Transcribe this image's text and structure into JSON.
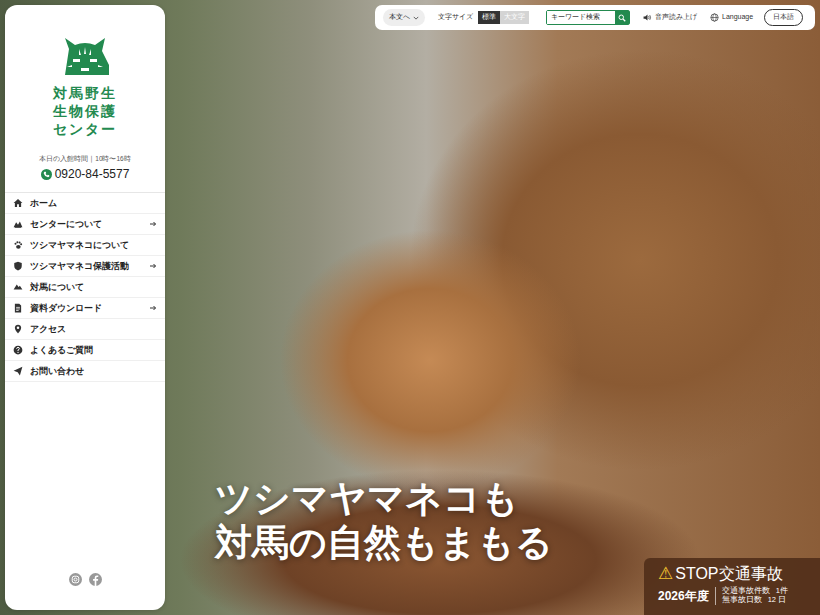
{
  "sidebar": {
    "title_lines": [
      "対馬野生",
      "生物保護",
      "センター"
    ],
    "hours": "本日の入館時間｜10時〜16時",
    "phone": "0920-84-5577",
    "menu": [
      {
        "label": "ホーム",
        "expandable": false
      },
      {
        "label": "センターについて",
        "expandable": true
      },
      {
        "label": "ツシマヤマネコについて",
        "expandable": false
      },
      {
        "label": "ツシマヤマネコ保護活動",
        "expandable": true
      },
      {
        "label": "対馬について",
        "expandable": false
      },
      {
        "label": "資料ダウンロード",
        "expandable": true
      },
      {
        "label": "アクセス",
        "expandable": false
      },
      {
        "label": "よくあるご質問",
        "expandable": false
      },
      {
        "label": "お問い合わせ",
        "expandable": false
      }
    ]
  },
  "toolbar": {
    "skip": "本文へ",
    "font_size_label": "文字サイズ",
    "font_sizes": [
      {
        "label": "標準",
        "selected": true
      },
      {
        "label": "大文字",
        "selected": false
      }
    ],
    "search": {
      "placeholder": "キーワード検索"
    },
    "read_aloud": "音声読み上げ",
    "language": "Language",
    "language_button": "日本語"
  },
  "hero": {
    "lines": [
      "ツシマヤマネコも",
      "対馬の自然もまもる"
    ]
  },
  "accident": {
    "icon": "⚠",
    "title": "STOP交通事故",
    "year": "2026年度",
    "stats": [
      {
        "label": "交通事故件数",
        "value": "1件"
      },
      {
        "label": "無事故日数",
        "value": "12 日"
      }
    ]
  }
}
